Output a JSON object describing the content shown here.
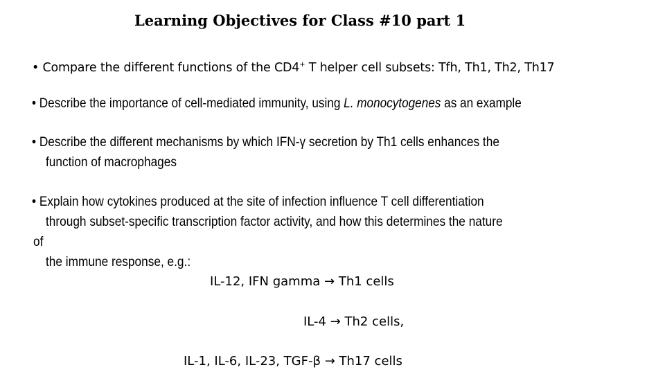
{
  "title": "Learning Objectives for Class #10 part 1",
  "bullet": "•",
  "objectives": [
    {
      "pre": "Compare the different functions of the CD4",
      "sup": "+",
      "post": " T helper cell subsets: Tfh, Th1, Th2, Th17"
    },
    {
      "pre": "Describe the importance of cell-mediated immunity, using ",
      "italic": "L. monocytogenes",
      "post": " as an example"
    },
    {
      "line1": "Describe the different mechanisms by which IFN-γ secretion by Th1 cells enhances the",
      "line2": "function of macrophages"
    },
    {
      "line1": "Explain how cytokines produced at the site of infection influence T cell differentiation",
      "line2": "through subset-specific transcription factor activity, and how this determines the nature",
      "line3": "of",
      "line4": "the immune response, e.g.:"
    }
  ],
  "examples": [
    {
      "cytokines": "IL-12, IFN gamma",
      "arrow": "→",
      "result": "Th1 cells"
    },
    {
      "cytokines": "IL-4",
      "arrow": "→",
      "result": "Th2 cells,"
    },
    {
      "cytokines": "IL-1, IL-6, IL-23, TGF-β",
      "arrow": "→",
      "result": "Th17 cells"
    }
  ]
}
